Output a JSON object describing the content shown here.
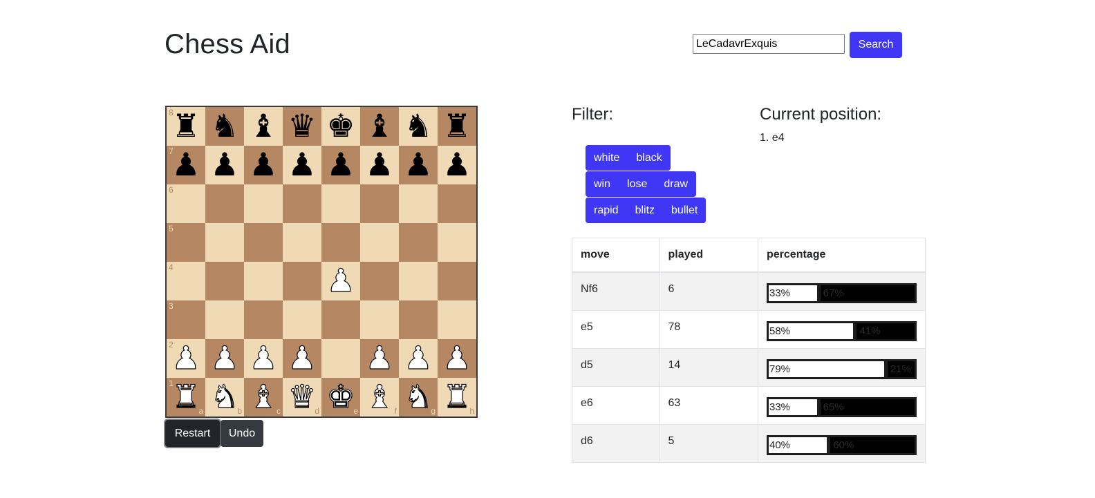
{
  "header": {
    "title": "Chess Aid"
  },
  "search": {
    "value": "LeCadavrExquis",
    "button_label": "Search"
  },
  "board": {
    "position": [
      [
        "bR",
        "bN",
        "bB",
        "bQ",
        "bK",
        "bB",
        "bN",
        "bR"
      ],
      [
        "bP",
        "bP",
        "bP",
        "bP",
        "bP",
        "bP",
        "bP",
        "bP"
      ],
      [
        "",
        "",
        "",
        "",
        "",
        "",
        "",
        ""
      ],
      [
        "",
        "",
        "",
        "",
        "",
        "",
        "",
        ""
      ],
      [
        "",
        "",
        "",
        "",
        "wP",
        "",
        "",
        ""
      ],
      [
        "",
        "",
        "",
        "",
        "",
        "",
        "",
        ""
      ],
      [
        "wP",
        "wP",
        "wP",
        "wP",
        "",
        "wP",
        "wP",
        "wP"
      ],
      [
        "wR",
        "wN",
        "wB",
        "wQ",
        "wK",
        "wB",
        "wN",
        "wR"
      ]
    ],
    "ranks": [
      "8",
      "7",
      "6",
      "5",
      "4",
      "3",
      "2",
      "1"
    ],
    "files": [
      "a",
      "b",
      "c",
      "d",
      "e",
      "f",
      "g",
      "h"
    ],
    "light_color": "#f0d9b5",
    "dark_color": "#b58863"
  },
  "controls": {
    "restart_label": "Restart",
    "undo_label": "Undo"
  },
  "filter": {
    "heading": "Filter:",
    "groups": [
      [
        "white",
        "black"
      ],
      [
        "win",
        "lose",
        "draw"
      ],
      [
        "rapid",
        "blitz",
        "bullet"
      ]
    ],
    "accent_color": "#3f37f5"
  },
  "current_position": {
    "heading": "Current position:",
    "moves": "1. e4"
  },
  "table": {
    "headers": [
      "move",
      "played",
      "percentage"
    ],
    "rows": [
      {
        "move": "Nf6",
        "played": "6",
        "white_pct": "33%",
        "black_pct": "67%",
        "white_fraction": 0.33
      },
      {
        "move": "e5",
        "played": "78",
        "white_pct": "58%",
        "black_pct": "41%",
        "white_fraction": 0.58
      },
      {
        "move": "d5",
        "played": "14",
        "white_pct": "79%",
        "black_pct": "21%",
        "white_fraction": 0.79
      },
      {
        "move": "e6",
        "played": "63",
        "white_pct": "33%",
        "black_pct": "65%",
        "white_fraction": 0.33
      },
      {
        "move": "d6",
        "played": "5",
        "white_pct": "40%",
        "black_pct": "60%",
        "white_fraction": 0.4
      }
    ]
  }
}
